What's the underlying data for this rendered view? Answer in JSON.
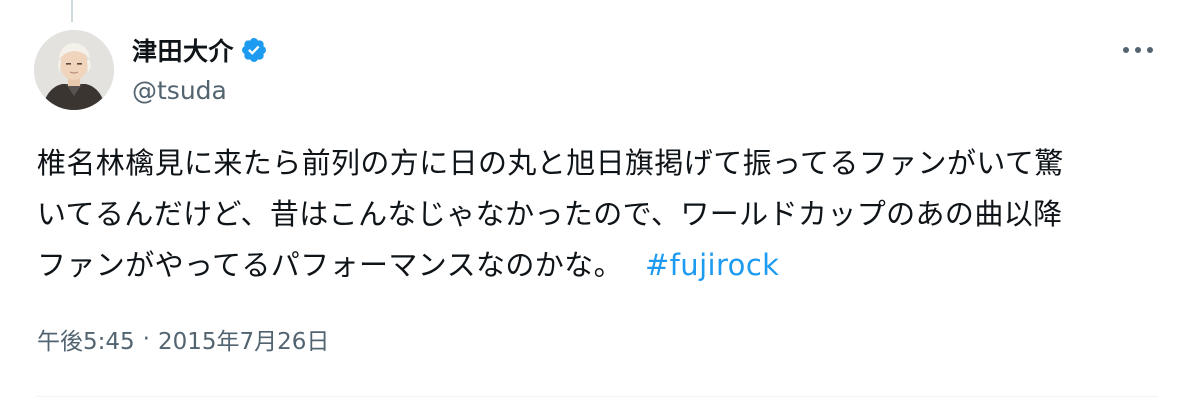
{
  "tweet": {
    "author": {
      "display_name": "津田大介",
      "handle": "@tsuda",
      "verified": true
    },
    "text_lines": [
      "椎名林檎見に来たら前列の方に日の丸と旭日旗掲げて振ってるファンがいて驚",
      "いてるんだけど、昔はこんなじゃなかったので、ワールドカップのあの曲以降",
      "ファンがやってるパフォーマンスなのかな。"
    ],
    "hashtag": "#fujirock",
    "time": "午後5:45",
    "separator": "·",
    "date": "2015年7月26日"
  },
  "icons": {
    "verified": "verified-badge-icon",
    "more": "more-dots-icon"
  },
  "colors": {
    "accent": "#1d9bf0",
    "text": "#0f1419",
    "secondary": "#536471"
  }
}
